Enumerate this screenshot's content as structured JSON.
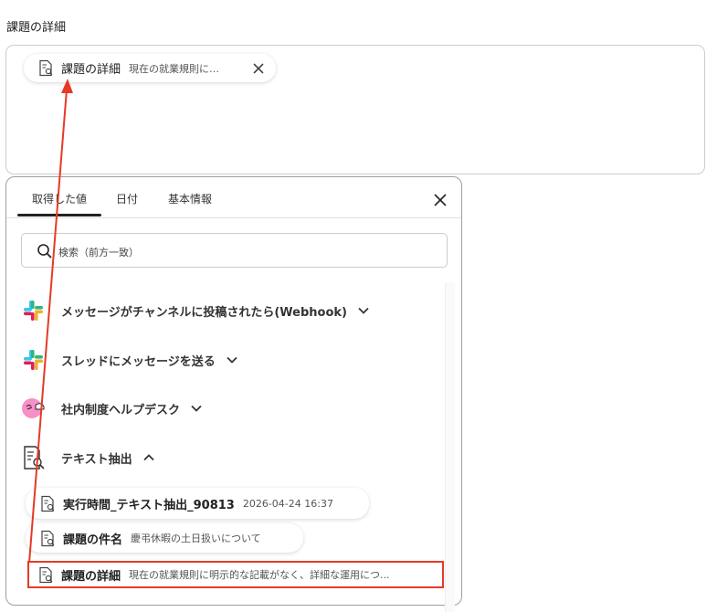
{
  "field": {
    "label": "課題の詳細",
    "chip": {
      "title": "課題の詳細",
      "value": "現在の就業規則に…"
    }
  },
  "panel": {
    "tabs": [
      {
        "label": "取得した値",
        "active": true
      },
      {
        "label": "日付",
        "active": false
      },
      {
        "label": "基本情報",
        "active": false
      }
    ],
    "search": {
      "placeholder": "検索（前方一致）",
      "value": ""
    },
    "groups": [
      {
        "title": "メッセージがチャンネルに投稿されたら(Webhook)",
        "icon": "slack-icon",
        "expanded": false
      },
      {
        "title": "スレッドにメッセージを送る",
        "icon": "slack-icon",
        "expanded": false
      },
      {
        "title": "社内制度ヘルプデスク",
        "icon": "helpdesk-icon",
        "expanded": false
      },
      {
        "title": "テキスト抽出",
        "icon": "document-search-icon",
        "expanded": true
      }
    ],
    "items": [
      {
        "title": "実行時間_テキスト抽出_90813",
        "value": "2026-04-24 16:37"
      },
      {
        "title": "課題の件名",
        "value": "慶弔休暇の土日扱いについて"
      },
      {
        "title": "課題の詳細",
        "value": "現在の就業規則に明示的な記載がなく、詳細な運用につ..."
      }
    ]
  },
  "colors": {
    "highlight": "#e53a26",
    "arrow": "#e53a26",
    "border": "#c9ccd1"
  }
}
